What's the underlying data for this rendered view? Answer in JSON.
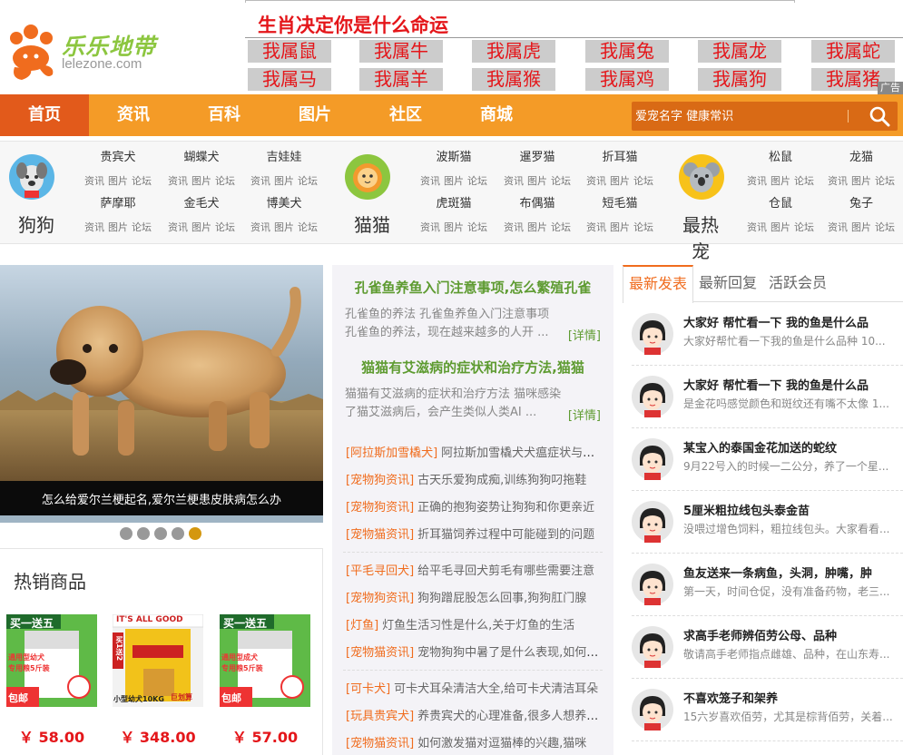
{
  "logo": {
    "brand_text": "乐乐地带",
    "domain": "lelezone.com"
  },
  "zodiac": {
    "title": "生肖决定你是什么命运",
    "row1": [
      "我属鼠",
      "我属牛",
      "我属虎",
      "我属兔",
      "我属龙",
      "我属蛇"
    ],
    "row2": [
      "我属马",
      "我属羊",
      "我属猴",
      "我属鸡",
      "我属狗",
      "我属猪"
    ],
    "ad_tag": "广告"
  },
  "nav": {
    "items": [
      "首页",
      "资讯",
      "百科",
      "图片",
      "社区",
      "商城"
    ],
    "active_index": 0,
    "search_placeholder": "爱宠名字 健康常识",
    "search_icon": "search-icon"
  },
  "colors": {
    "nav": "#f49b27",
    "nav_active": "#e25a1b",
    "accent": "#f06c1e",
    "green": "#5e9b31",
    "red": "#e4161a"
  },
  "categories": [
    {
      "name": "狗狗",
      "icon": "dog-icon",
      "breeds": [
        "贵宾犬",
        "蝴蝶犬",
        "吉娃娃",
        "萨摩耶",
        "金毛犬",
        "博美犬"
      ]
    },
    {
      "name": "猫猫",
      "icon": "cat-icon",
      "breeds": [
        "波斯猫",
        "暹罗猫",
        "折耳猫",
        "虎斑猫",
        "布偶猫",
        "短毛猫"
      ]
    },
    {
      "name": "最热宠",
      "icon": "koala-icon",
      "breeds": [
        "松鼠",
        "龙猫",
        "仓鼠",
        "兔子"
      ]
    }
  ],
  "breed_links": [
    "资讯",
    "图片",
    "论坛"
  ],
  "slider": {
    "caption": "怎么给爱尔兰梗起名,爱尔兰梗患皮肤病怎么办",
    "dot_count": 5,
    "active_dot": 4
  },
  "hot_products": {
    "title": "热销商品",
    "items": [
      {
        "banner": "买一送五",
        "label1": "通用型幼犬",
        "label2": "专用粮5斤装",
        "label3": "包邮",
        "price": "￥ 58.00"
      },
      {
        "banner": "IT'S ALL GOOD",
        "label1": "小型幼犬10KG",
        "label2": "巨划算",
        "label3": "买1送2",
        "price": "￥ 348.00"
      },
      {
        "banner": "买一送五",
        "label1": "通用型成犬",
        "label2": "专用粮5斤装",
        "label3": "包邮",
        "price": "￥ 57.00"
      }
    ]
  },
  "featured": [
    {
      "title": "孔雀鱼养鱼入门注意事项,怎么繁殖孔雀",
      "desc": "孔雀鱼的养法 孔雀鱼养鱼入门注意事项 孔雀鱼的养法，现在越来越多的人开 ...",
      "more": "[详情]"
    },
    {
      "title": "猫猫有艾滋病的症状和治疗方法,猫猫",
      "desc": "猫猫有艾滋病的症状和治疗方法 猫咪感染了猫艾滋病后，会产生类似人类AI ...",
      "more": "[详情]"
    }
  ],
  "news_groups": [
    [
      {
        "tag": "[阿拉斯加雪橇犬]",
        "text": "阿拉斯加雪橇犬犬瘟症状与治疗"
      },
      {
        "tag": "[宠物狗资讯]",
        "text": "古天乐爱狗成痴,训练狗狗叼拖鞋"
      },
      {
        "tag": "[宠物狗资讯]",
        "text": "正确的抱狗姿势让狗狗和你更亲近"
      },
      {
        "tag": "[宠物猫资讯]",
        "text": "折耳猫饲养过程中可能碰到的问题"
      }
    ],
    [
      {
        "tag": "[平毛寻回犬]",
        "text": "给平毛寻回犬剪毛有哪些需要注意"
      },
      {
        "tag": "[宠物狗资讯]",
        "text": "狗狗蹭屁股怎么回事,狗狗肛门腺"
      },
      {
        "tag": "[灯鱼]",
        "text": "灯鱼生活习性是什么,关于灯鱼的生活"
      },
      {
        "tag": "[宠物猫资讯]",
        "text": "宠物狗狗中暑了是什么表现,如何处理"
      }
    ],
    [
      {
        "tag": "[可卡犬]",
        "text": "可卡犬耳朵清洁大全,给可卡犬清洁耳朵"
      },
      {
        "tag": "[玩具贵宾犬]",
        "text": "养贵宾犬的心理准备,很多人想养贵宾"
      },
      {
        "tag": "[宠物猫资讯]",
        "text": "如何激发猫对逗猫棒的兴趣,猫咪"
      }
    ]
  ],
  "right_panel": {
    "tabs": [
      "最新发表",
      "最新回复",
      "活跃会员"
    ],
    "active_tab": 0,
    "posts": [
      {
        "title": "大家好 帮忙看一下 我的鱼是什么品",
        "desc": "大家好帮忙看一下我的鱼是什么品种 10..."
      },
      {
        "title": "大家好 帮忙看一下 我的鱼是什么品",
        "desc": "是金花吗感觉颜色和斑纹还有嘴不太像 1..."
      },
      {
        "title": "某宝入的泰国金花加送的蛇纹",
        "desc": "9月22号入的时候一二公分，养了一个星..."
      },
      {
        "title": "5厘米粗拉线包头泰金苗",
        "desc": "没喂过增色饲料，粗拉线包头。大家看看..."
      },
      {
        "title": "鱼友送来一条病鱼，头洞，肿嘴，肿",
        "desc": "第一天，时间仓促，没有准备药物，老三..."
      },
      {
        "title": "求高手老师辨佰劳公母、品种",
        "desc": "敬请高手老师指点雌雄、品种，在山东寿..."
      },
      {
        "title": "不喜欢笼子和架养",
        "desc": "15六岁喜欢佰劳，尤其是棕背佰劳，关着..."
      }
    ]
  }
}
